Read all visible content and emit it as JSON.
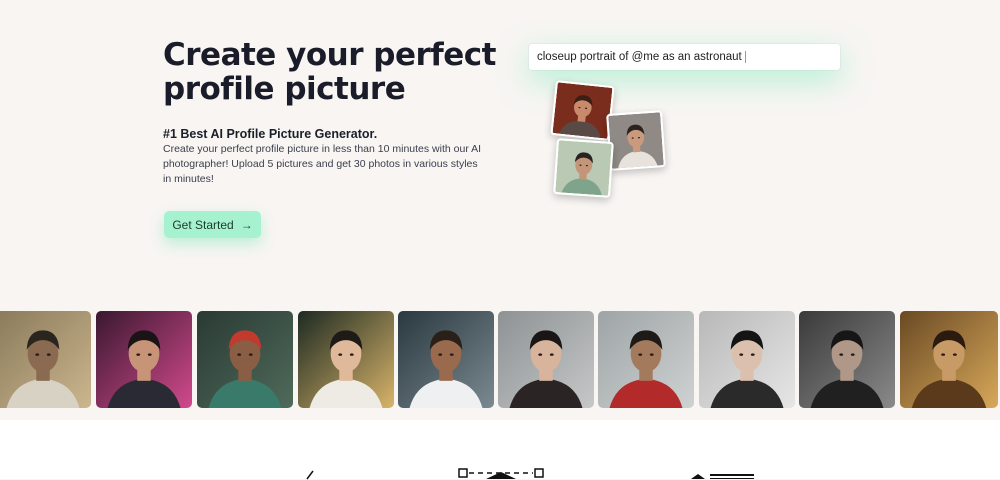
{
  "hero": {
    "headline": "Create your perfect\nprofile picture",
    "tagline": "#1 Best AI Profile Picture Generator.",
    "description": "Create your perfect profile picture in less than 10 minutes with our AI photographer! Upload 5 pictures and get 30 photos in various styles in minutes!",
    "cta_label": "Get Started",
    "cta_icon": "arrow-right-icon"
  },
  "prompt": {
    "text": "closeup portrait of @me as an astronaut"
  },
  "sample_thumbnails": [
    {
      "name": "sample-photo-red-background",
      "bg": "#7a2d1c",
      "skin": "#c88a6a",
      "hair": "#3b1e14",
      "shirt": "#5a4a46"
    },
    {
      "name": "sample-photo-gray-background",
      "bg": "#8f8a86",
      "skin": "#c99a7d",
      "hair": "#2c2320",
      "shirt": "#e8e2dc"
    },
    {
      "name": "sample-photo-green-background",
      "bg": "#b9c9b4",
      "skin": "#c3967a",
      "hair": "#2a2220",
      "shirt": "#7ea58c"
    }
  ],
  "gallery": [
    {
      "name": "gallery-portrait-forest",
      "bg": "#8a7a5a",
      "bg2": "#cbb68e",
      "skin": "#8a6a50",
      "hair": "#2b2520",
      "shirt": "#d8d2c4"
    },
    {
      "name": "gallery-portrait-neon-city",
      "bg": "#3a1830",
      "bg2": "#d24a8c",
      "skin": "#c79478",
      "hair": "#1b1416",
      "shirt": "#2a2a34"
    },
    {
      "name": "gallery-portrait-red-hair",
      "bg": "#2a3a34",
      "bg2": "#4f6a5a",
      "skin": "#8a5e45",
      "hair": "#c23a2e",
      "shirt": "#3a7a6a"
    },
    {
      "name": "gallery-portrait-astronaut-woman",
      "bg": "#1d2a22",
      "bg2": "#d8b46a",
      "skin": "#e0b89a",
      "hair": "#1e1a18",
      "shirt": "#eeeae4"
    },
    {
      "name": "gallery-portrait-astronaut-man",
      "bg": "#2a3840",
      "bg2": "#7a8a90",
      "skin": "#9a6a4e",
      "hair": "#2a201a",
      "shirt": "#eef0f2"
    },
    {
      "name": "gallery-portrait-misty-woman",
      "bg": "#8e9294",
      "bg2": "#c6c8c8",
      "skin": "#d8b49c",
      "hair": "#1a1616",
      "shirt": "#2a2424"
    },
    {
      "name": "gallery-portrait-samurai",
      "bg": "#9ea4a6",
      "bg2": "#cfd2d2",
      "skin": "#a47a5c",
      "hair": "#1e1a18",
      "shirt": "#b22a2a"
    },
    {
      "name": "gallery-portrait-bw-woman",
      "bg": "#b8b8b8",
      "bg2": "#e6e6e6",
      "skin": "#dcc0ae",
      "hair": "#141414",
      "shirt": "#2a2a2a"
    },
    {
      "name": "gallery-portrait-bw-man",
      "bg": "#3a3a3a",
      "bg2": "#8a8a8a",
      "skin": "#b09888",
      "hair": "#161616",
      "shirt": "#202020"
    },
    {
      "name": "gallery-portrait-tattoo-art",
      "bg": "#6a4a24",
      "bg2": "#d8a85a",
      "skin": "#c89a66",
      "hair": "#2a1a10",
      "shirt": "#5a3a1a"
    }
  ]
}
